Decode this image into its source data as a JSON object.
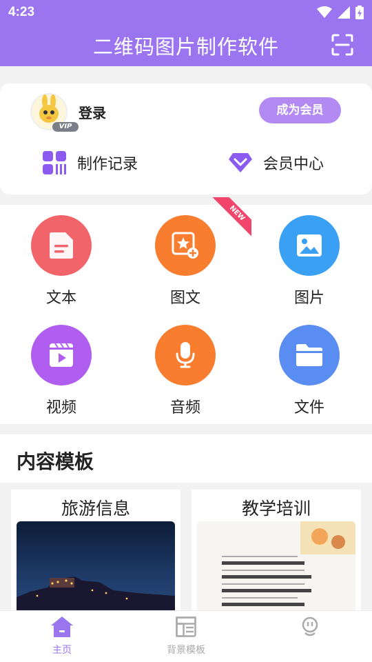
{
  "status_bar": {
    "time": "4:23"
  },
  "header": {
    "title": "二维码图片制作软件",
    "scan_icon": "scan-icon"
  },
  "user": {
    "login_label": "登录",
    "vip_tag": "VIP",
    "become_vip_label": "成为会员",
    "links": [
      {
        "label": "制作记录",
        "icon": "records-icon"
      },
      {
        "label": "会员中心",
        "icon": "diamond-icon"
      }
    ]
  },
  "tools": [
    {
      "label": "文本",
      "icon": "document-icon",
      "color": "#f0646a"
    },
    {
      "label": "图文",
      "icon": "image-text-icon",
      "color": "#f97d2e",
      "badge": "NEW"
    },
    {
      "label": "图片",
      "icon": "image-icon",
      "color": "#3aa0f3"
    },
    {
      "label": "视频",
      "icon": "video-icon",
      "color": "#b05ef0"
    },
    {
      "label": "音频",
      "icon": "microphone-icon",
      "color": "#f97d2e"
    },
    {
      "label": "文件",
      "icon": "folder-icon",
      "color": "#5a8df2"
    }
  ],
  "templates": {
    "title": "内容模板",
    "items": [
      {
        "name": "旅游信息"
      },
      {
        "name": "教学培训"
      }
    ]
  },
  "bottom_nav": [
    {
      "label": "主页",
      "icon": "home-icon",
      "active": true
    },
    {
      "label": "背景模板",
      "icon": "template-icon",
      "active": false
    },
    {
      "label": "",
      "icon": "profile-icon",
      "active": false
    }
  ],
  "colors": {
    "primary": "#9b74f0",
    "vip_button": "#b38af2",
    "nav_active": "#9b74f0",
    "nav_inactive": "#aaaaaa"
  }
}
